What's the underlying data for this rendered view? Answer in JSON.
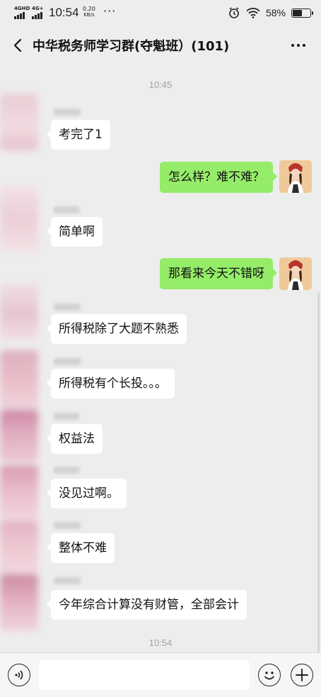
{
  "status_bar": {
    "signal_1": "4GHD",
    "signal_2": "4G+",
    "time": "10:54",
    "net_speed": "0.20",
    "net_unit": "KB/s",
    "overflow": "···",
    "battery_pct": "58%",
    "battery_level": 0.58
  },
  "header": {
    "title": "中华税务师学习群(夺魁班）(101)"
  },
  "chat": {
    "timestamp_top": "10:45",
    "messages": [
      {
        "from": "other",
        "text": "考完了1"
      },
      {
        "from": "me",
        "text": "怎么样？难不难？"
      },
      {
        "from": "other",
        "text": "简单啊"
      },
      {
        "from": "me",
        "text": "那看来今天不错呀"
      },
      {
        "from": "other",
        "text": "所得税除了大题不熟悉"
      },
      {
        "from": "other",
        "text": "所得税有个长投。。。"
      },
      {
        "from": "other",
        "text": "权益法"
      },
      {
        "from": "other",
        "text": "没见过啊。"
      },
      {
        "from": "other",
        "text": "整体不难"
      },
      {
        "from": "other",
        "text": "今年综合计算没有财管，全部会计"
      }
    ],
    "timestamp_bottom": "10:54"
  },
  "input_bar": {
    "voice_icon": "voice-icon",
    "emoji_icon": "emoji-icon",
    "plus_icon": "plus-icon",
    "value": ""
  },
  "colors": {
    "background": "#ededed",
    "my_bubble": "#95ec69",
    "other_bubble": "#ffffff"
  }
}
